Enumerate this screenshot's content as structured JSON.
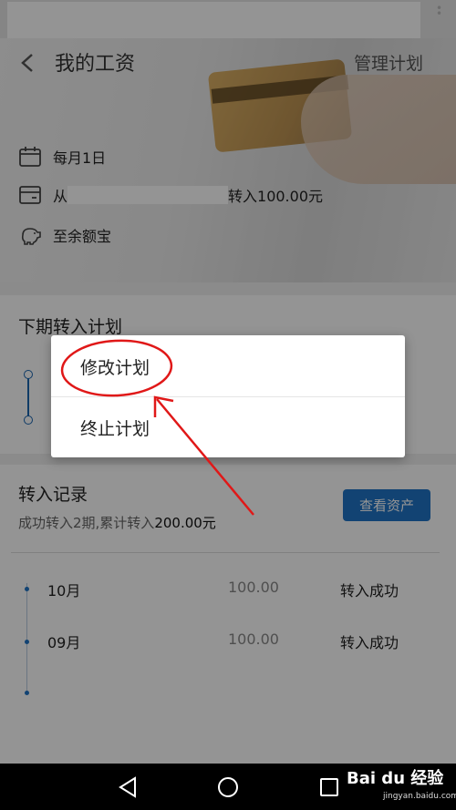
{
  "header": {
    "title": "我的工资",
    "manage_label": "管理计划",
    "date_text": "每月1日",
    "from_prefix": "从",
    "transfer_text": "转入100.00元",
    "dest_text": "至余额宝"
  },
  "plan": {
    "title": "下期转入计划"
  },
  "dialog": {
    "items": [
      "修改计划",
      "终止计划"
    ]
  },
  "records": {
    "title": "转入记录",
    "summary_prefix": "成功转入2期,累计转入",
    "summary_amount": "200.00元",
    "view_button": "查看资产",
    "rows": [
      {
        "month": "10月",
        "amount": "100.00",
        "status": "转入成功"
      },
      {
        "month": "09月",
        "amount": "100.00",
        "status": "转入成功"
      }
    ]
  },
  "watermark": {
    "logo": "Bai du 经验",
    "url": "jingyan.baidu.com"
  },
  "colors": {
    "accent": "#1f74c7",
    "annotation": "#e01818"
  }
}
